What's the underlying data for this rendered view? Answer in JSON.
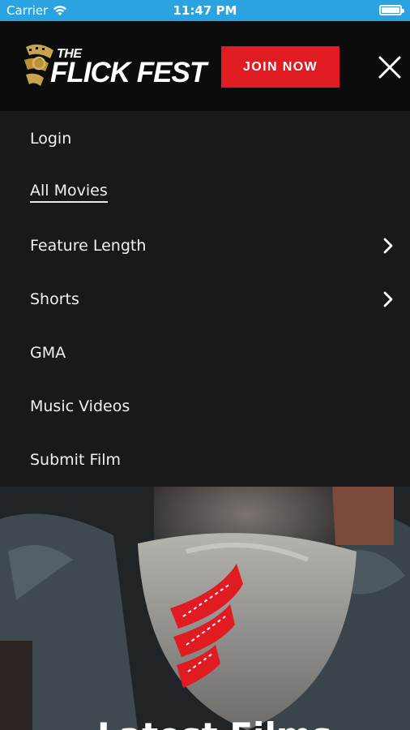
{
  "status_bar": {
    "carrier": "Carrier",
    "time": "11:47 PM",
    "battery_level": 1.0
  },
  "header": {
    "logo_the": "THE",
    "logo_name": "FLICK FEST",
    "join_button_label": "JOIN NOW",
    "close_icon": "close-icon"
  },
  "menu": {
    "items": [
      {
        "label": "Login",
        "active": false,
        "has_submenu": false
      },
      {
        "label": "All Movies",
        "active": true,
        "has_submenu": false
      },
      {
        "label": "Feature Length",
        "active": false,
        "has_submenu": true
      },
      {
        "label": "Shorts",
        "active": false,
        "has_submenu": true
      },
      {
        "label": "GMA",
        "active": false,
        "has_submenu": false
      },
      {
        "label": "Music Videos",
        "active": false,
        "has_submenu": false
      },
      {
        "label": "Submit Film",
        "active": false,
        "has_submenu": false
      }
    ]
  },
  "hero": {
    "title": "Latest Films"
  },
  "colors": {
    "status_bar": "#2aa3e0",
    "header_bg": "#0c0c0c",
    "menu_bg": "#191919",
    "accent_red": "#e11b22",
    "logo_gold": "#c9a44a",
    "text": "#f1f1f1"
  }
}
